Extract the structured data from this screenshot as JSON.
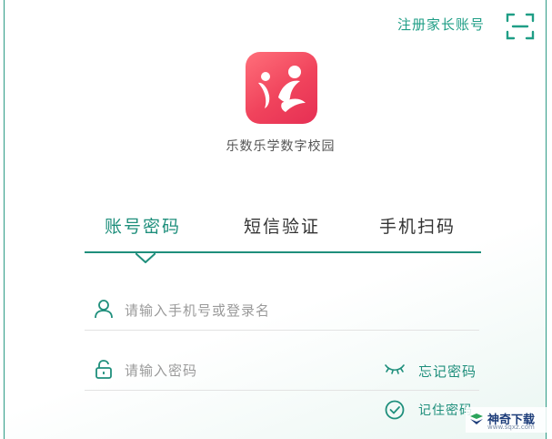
{
  "header": {
    "register_link": "注册家长账号",
    "scan_icon": "scan-frame-icon"
  },
  "app": {
    "logo_icon": "app-logo",
    "name": "乐数乐学数字校园"
  },
  "tabs": [
    {
      "label": "账号密码",
      "active": true
    },
    {
      "label": "短信验证",
      "active": false
    },
    {
      "label": "手机扫码",
      "active": false
    }
  ],
  "form": {
    "username_placeholder": "请输入手机号或登录名",
    "password_placeholder": "请输入密码",
    "forgot_password": "忘记密码",
    "remember_password": "记住密码",
    "icons": {
      "user": "user-icon",
      "lock": "lock-icon",
      "eye": "eye-closed-icon",
      "check": "check-circle-icon"
    }
  },
  "watermark": {
    "text": "神奇下载",
    "url": "www.sqxz.com"
  },
  "colors": {
    "accent": "#1f8f7c",
    "logo": "#f0435c"
  }
}
